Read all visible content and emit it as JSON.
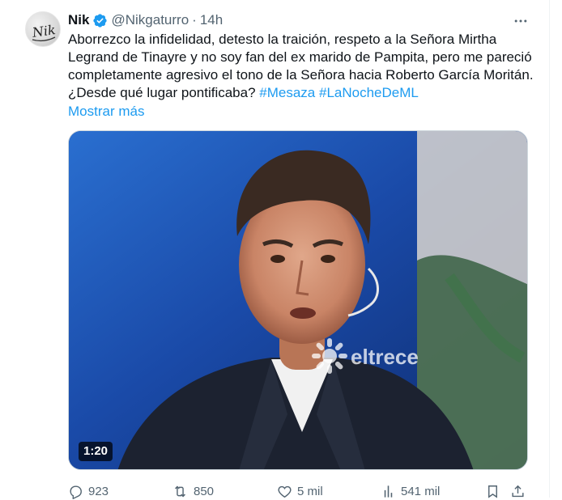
{
  "tweet": {
    "author_name": "Nik",
    "author_handle": "@Nikgaturro",
    "separator": "·",
    "time": "14h",
    "avatar_text": "Nik",
    "text_lines": [
      "Aborrezco la infidelidad, detesto la traición, respeto a la Señora Mirtha",
      "Legrand de Tinayre y no soy fan del ex marido de Pampita, pero me pareció",
      "completamente agresivo el tono de la Señora hacia Roberto García Moritán.",
      "¿Desde qué lugar pontificaba?"
    ],
    "hashtags": [
      "#Mesaza",
      "#LaNocheDeML"
    ],
    "show_more": "Mostrar más",
    "media": {
      "duration": "1:20",
      "watermark": "eltrece"
    },
    "actions": {
      "replies": "923",
      "retweets": "850",
      "likes": "5 mil",
      "views": "541 mil"
    }
  },
  "icons": {
    "verified": "verified-badge-icon",
    "more": "more-options-icon",
    "reply": "reply-icon",
    "retweet": "retweet-icon",
    "like": "heart-icon",
    "views": "views-chart-icon",
    "bookmark": "bookmark-icon",
    "share": "share-icon"
  },
  "colors": {
    "accent": "#1d9bf0",
    "secondary_text": "#536471",
    "primary_text": "#0f1419"
  }
}
